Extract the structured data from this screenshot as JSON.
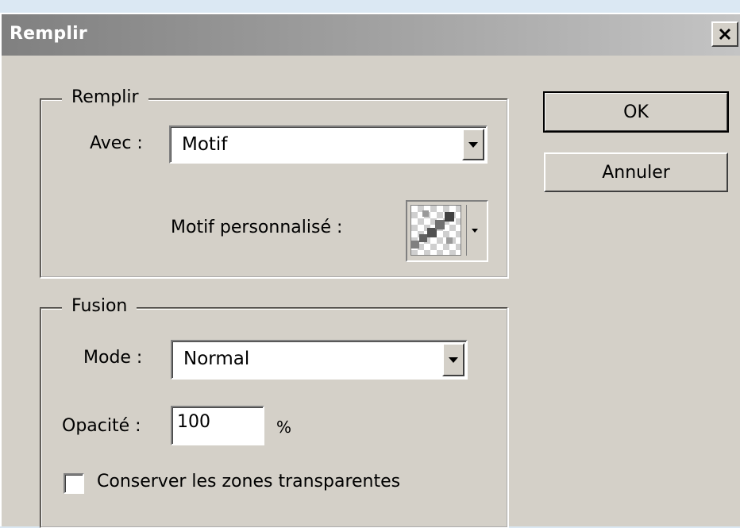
{
  "window": {
    "title": "Remplir",
    "close_glyph": "✕"
  },
  "fill_group": {
    "legend": "Remplir",
    "with_label": "Avec :",
    "with_value": "Motif",
    "custom_pattern_label": "Motif personnalisé :",
    "pattern_icon": "checker-pattern-icon"
  },
  "blend_group": {
    "legend": "Fusion",
    "mode_label": "Mode :",
    "mode_value": "Normal",
    "opacity_label": "Opacité :",
    "opacity_value": "100",
    "opacity_unit": "%",
    "preserve_label": "Conserver les zones transparentes",
    "preserve_checked": false
  },
  "buttons": {
    "ok": "OK",
    "cancel": "Annuler"
  },
  "colors": {
    "dialog_bg": "#d4d0c8",
    "title_start": "#808080",
    "title_end": "#c4c4c4",
    "outer_bg": "#dbe8f3"
  }
}
